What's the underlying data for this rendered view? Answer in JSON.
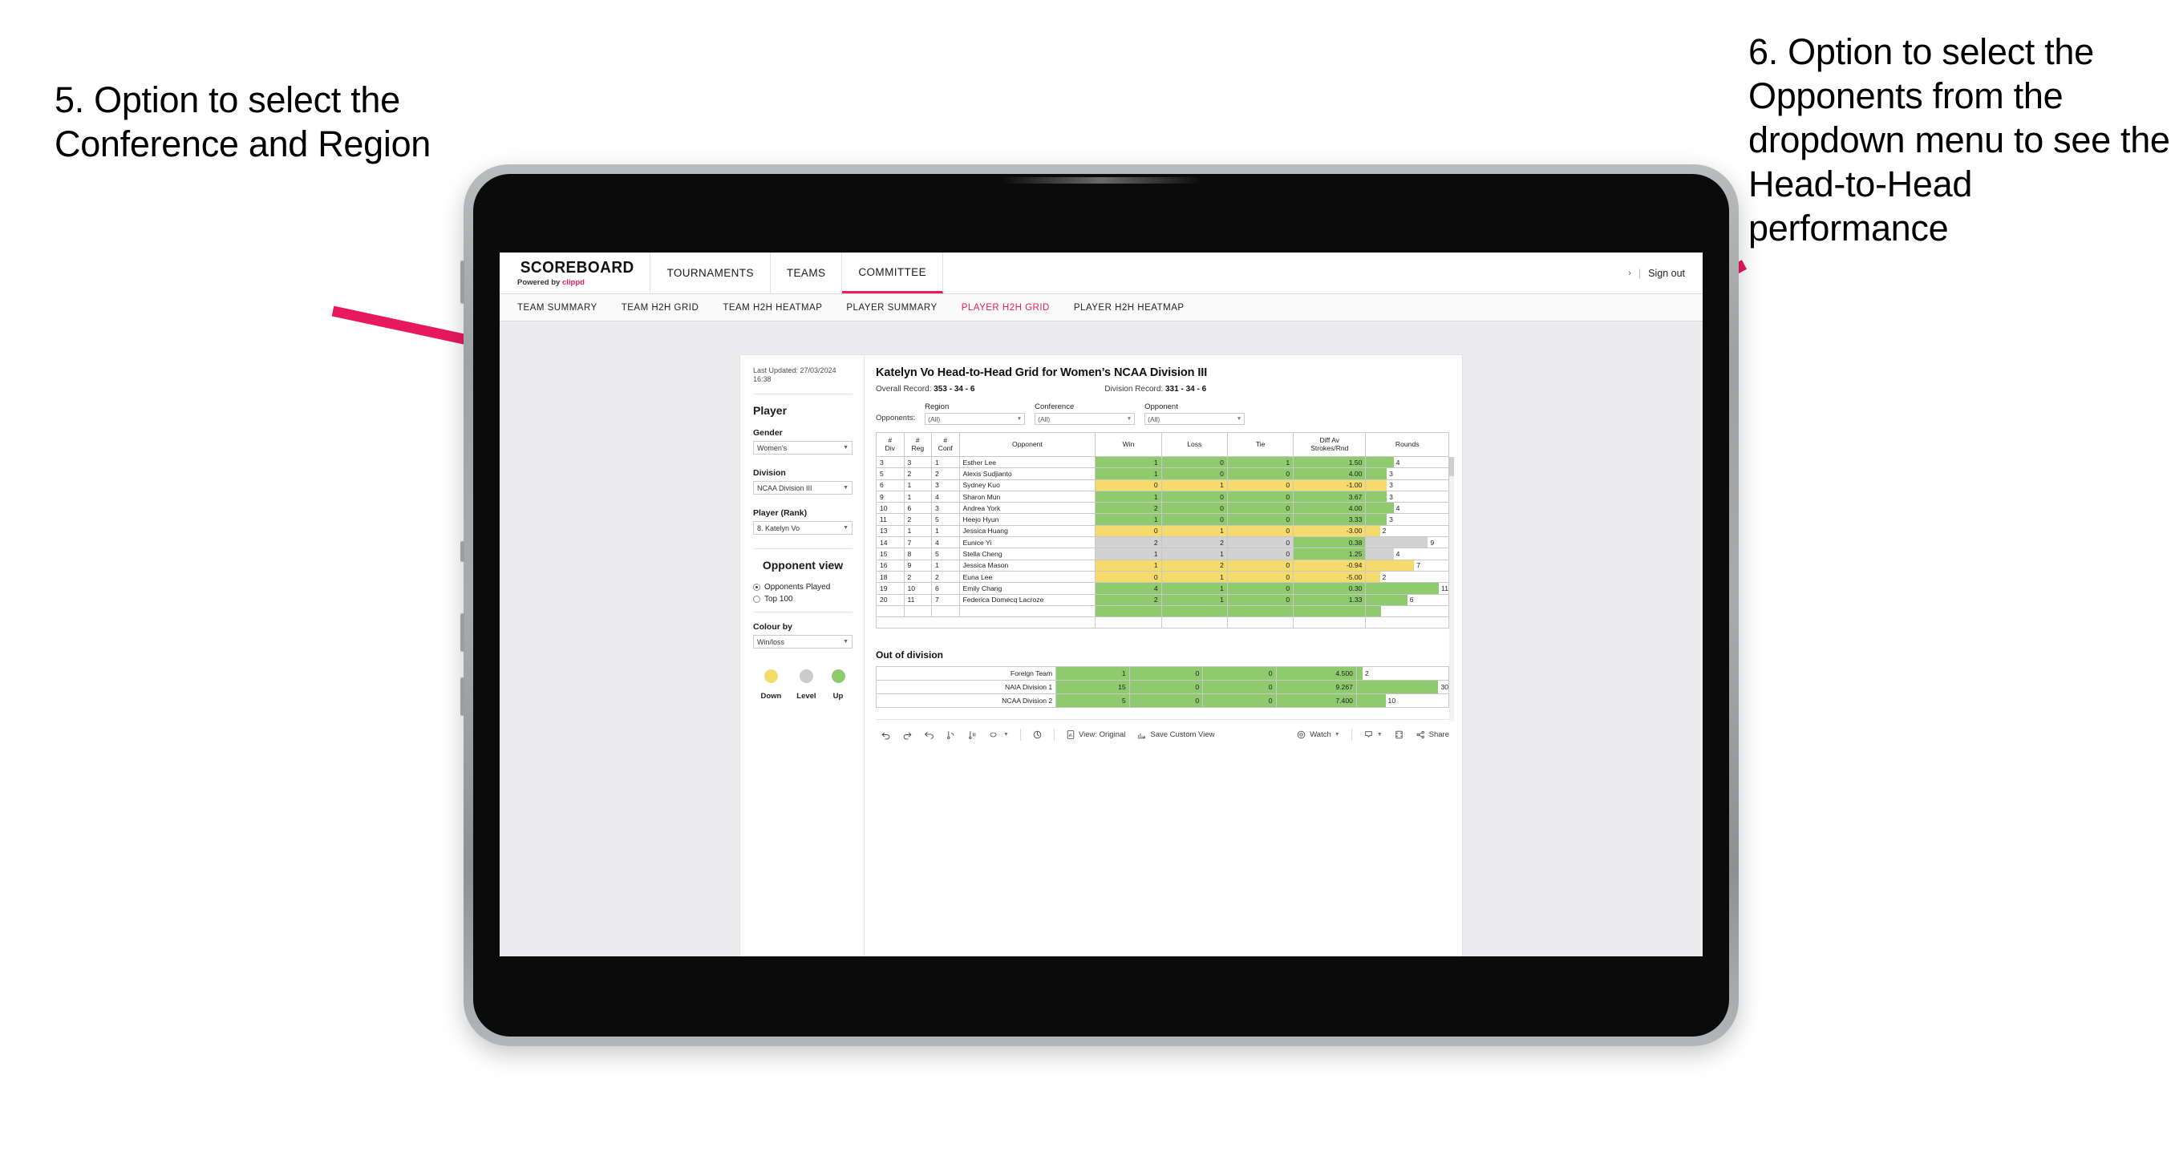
{
  "annotations": {
    "left": "5. Option to select the Conference and Region",
    "right": "6. Option to select the Opponents from the dropdown menu to see the Head-to-Head performance"
  },
  "app": {
    "brand": {
      "name": "SCOREBOARD",
      "powered_prefix": "Powered by ",
      "powered_brand": "clippd"
    },
    "topnav": [
      {
        "label": "TOURNAMENTS",
        "active": false
      },
      {
        "label": "TEAMS",
        "active": false
      },
      {
        "label": "COMMITTEE",
        "active": true
      }
    ],
    "topnav_right": {
      "chevron": "›",
      "pipe": "|",
      "signout": "Sign out"
    },
    "subnav": [
      {
        "label": "TEAM SUMMARY",
        "active": false
      },
      {
        "label": "TEAM H2H GRID",
        "active": false
      },
      {
        "label": "TEAM H2H HEATMAP",
        "active": false
      },
      {
        "label": "PLAYER SUMMARY",
        "active": false
      },
      {
        "label": "PLAYER H2H GRID",
        "active": true
      },
      {
        "label": "PLAYER H2H HEATMAP",
        "active": false
      }
    ]
  },
  "sidebar": {
    "last_updated": "Last Updated: 27/03/2024 16:38",
    "player_heading": "Player",
    "gender": {
      "label": "Gender",
      "value": "Women's"
    },
    "division": {
      "label": "Division",
      "value": "NCAA Division III"
    },
    "player_rank": {
      "label": "Player (Rank)",
      "value": "8. Katelyn Vo"
    },
    "opponent_view": {
      "heading": "Opponent view",
      "options": [
        {
          "label": "Opponents Played",
          "selected": true
        },
        {
          "label": "Top 100",
          "selected": false
        }
      ]
    },
    "colour_by": {
      "label": "Colour by",
      "value": "Win/loss"
    },
    "legend": [
      {
        "label": "Down",
        "color": "#f4db6b"
      },
      {
        "label": "Level",
        "color": "#c9cbcd"
      },
      {
        "label": "Up",
        "color": "#8fcb6e"
      }
    ]
  },
  "main": {
    "title": "Katelyn Vo Head-to-Head Grid for Women’s NCAA Division III",
    "overall_record": {
      "label": "Overall Record: ",
      "value": "353 - 34 - 6"
    },
    "division_record": {
      "label": "Division Record: ",
      "value": "331 - 34 - 6"
    },
    "filters_label": "Opponents:",
    "filters": [
      {
        "label": "Region",
        "value": "(All)"
      },
      {
        "label": "Conference",
        "value": "(All)"
      },
      {
        "label": "Opponent",
        "value": "(All)"
      }
    ],
    "out_of_division_heading": "Out of division"
  },
  "chart_data": {
    "type": "table",
    "title": "Katelyn Vo Head-to-Head Grid for Women’s NCAA Division III",
    "columns": [
      "# Div",
      "# Reg",
      "# Conf",
      "Opponent",
      "Win",
      "Loss",
      "Tie",
      "Diff Av Strokes/Rnd",
      "Rounds"
    ],
    "column_headers_multiline": [
      {
        "l1": "#",
        "l2": "Div"
      },
      {
        "l1": "#",
        "l2": "Reg"
      },
      {
        "l1": "#",
        "l2": "Conf"
      },
      {
        "l1": "Opponent",
        "l2": ""
      },
      {
        "l1": "Win",
        "l2": ""
      },
      {
        "l1": "Loss",
        "l2": ""
      },
      {
        "l1": "Tie",
        "l2": ""
      },
      {
        "l1": "Diff Av",
        "l2": "Strokes/Rnd"
      },
      {
        "l1": "Rounds",
        "l2": ""
      }
    ],
    "rounds_max": 12,
    "rows": [
      {
        "div": "3",
        "reg": "3",
        "conf": "1",
        "opponent": "Esther Lee",
        "win": "1",
        "loss": "0",
        "tie": "1",
        "diff": "1.50",
        "rounds": 4,
        "state": "win"
      },
      {
        "div": "5",
        "reg": "2",
        "conf": "2",
        "opponent": "Alexis Sudjianto",
        "win": "1",
        "loss": "0",
        "tie": "0",
        "diff": "4.00",
        "rounds": 3,
        "state": "win"
      },
      {
        "div": "6",
        "reg": "1",
        "conf": "3",
        "opponent": "Sydney Kuo",
        "win": "0",
        "loss": "1",
        "tie": "0",
        "diff": "-1.00",
        "rounds": 3,
        "state": "loss"
      },
      {
        "div": "9",
        "reg": "1",
        "conf": "4",
        "opponent": "Sharon Mun",
        "win": "1",
        "loss": "0",
        "tie": "0",
        "diff": "3.67",
        "rounds": 3,
        "state": "win"
      },
      {
        "div": "10",
        "reg": "6",
        "conf": "3",
        "opponent": "Andrea York",
        "win": "2",
        "loss": "0",
        "tie": "0",
        "diff": "4.00",
        "rounds": 4,
        "state": "win"
      },
      {
        "div": "11",
        "reg": "2",
        "conf": "5",
        "opponent": "Heejo Hyun",
        "win": "1",
        "loss": "0",
        "tie": "0",
        "diff": "3.33",
        "rounds": 3,
        "state": "win"
      },
      {
        "div": "13",
        "reg": "1",
        "conf": "1",
        "opponent": "Jessica Huang",
        "win": "0",
        "loss": "1",
        "tie": "0",
        "diff": "-3.00",
        "rounds": 2,
        "state": "loss"
      },
      {
        "div": "14",
        "reg": "7",
        "conf": "4",
        "opponent": "Eunice Yi",
        "win": "2",
        "loss": "2",
        "tie": "0",
        "diff": "0.38",
        "rounds": 9,
        "state": "level",
        "diff_state": "win"
      },
      {
        "div": "15",
        "reg": "8",
        "conf": "5",
        "opponent": "Stella Cheng",
        "win": "1",
        "loss": "1",
        "tie": "0",
        "diff": "1.25",
        "rounds": 4,
        "state": "level",
        "diff_state": "win"
      },
      {
        "div": "16",
        "reg": "9",
        "conf": "1",
        "opponent": "Jessica Mason",
        "win": "1",
        "loss": "2",
        "tie": "0",
        "diff": "-0.94",
        "rounds": 7,
        "state": "loss"
      },
      {
        "div": "18",
        "reg": "2",
        "conf": "2",
        "opponent": "Euna Lee",
        "win": "0",
        "loss": "1",
        "tie": "0",
        "diff": "-5.00",
        "rounds": 2,
        "state": "loss"
      },
      {
        "div": "19",
        "reg": "10",
        "conf": "6",
        "opponent": "Emily Chang",
        "win": "4",
        "loss": "1",
        "tie": "0",
        "diff": "0.30",
        "rounds": 11,
        "state": "win"
      },
      {
        "div": "20",
        "reg": "11",
        "conf": "7",
        "opponent": "Federica Domecq Lacroze",
        "win": "2",
        "loss": "1",
        "tie": "0",
        "diff": "1.33",
        "rounds": 6,
        "state": "win"
      }
    ],
    "out_of_division": {
      "rounds_max": 32,
      "rows": [
        {
          "name": "Foreign Team",
          "win": "1",
          "loss": "0",
          "tie": "0",
          "diff": "4.500",
          "rounds": 2,
          "state": "win"
        },
        {
          "name": "NAIA Division 1",
          "win": "15",
          "loss": "0",
          "tie": "0",
          "diff": "9.267",
          "rounds": 30,
          "state": "win"
        },
        {
          "name": "NCAA Division 2",
          "win": "5",
          "loss": "0",
          "tie": "0",
          "diff": "7.400",
          "rounds": 10,
          "state": "win"
        }
      ]
    }
  },
  "vizbar": {
    "undo": "undo-icon",
    "redo": "redo-icon",
    "revert": "revert-icon",
    "refresh": "refresh-data-icon",
    "pause": "pause-updates-icon",
    "view_original_label": "View: Original",
    "save_custom_view_label": "Save Custom View",
    "watch_label": "Watch",
    "share_label": "Share"
  }
}
